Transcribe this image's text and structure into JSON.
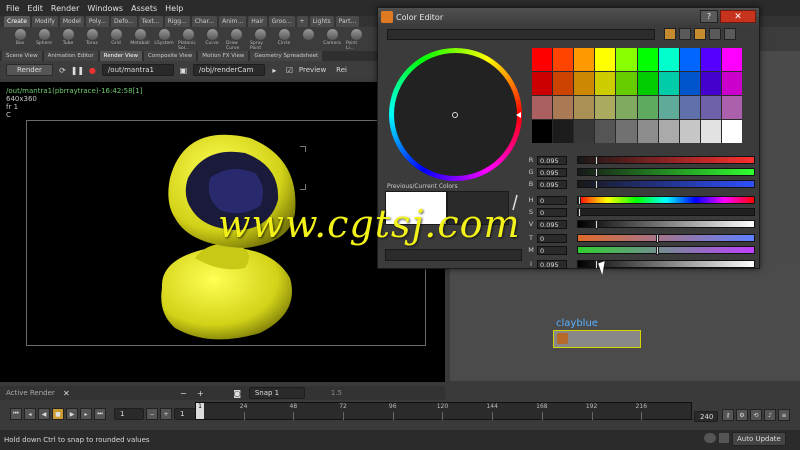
{
  "menu": [
    "File",
    "Edit",
    "Render",
    "Windows",
    "Assets",
    "Help"
  ],
  "shelf": {
    "tabs": [
      "Create",
      "Modify",
      "Model",
      "Poly...",
      "Defo...",
      "Text...",
      "Rigg...",
      "Char...",
      "Anim...",
      "Hair",
      "Groo...",
      "+",
      "Lights",
      "Part..."
    ],
    "tools": [
      "Box",
      "Sphere",
      "Tube",
      "Torus",
      "Grid",
      "Metaball",
      "LSystem",
      "Platonic Sol...",
      "Curve",
      "Draw Curve",
      "Spray Paint",
      "Circle",
      "",
      "Camera",
      "Point Li..."
    ]
  },
  "pane_tabs": [
    "Scene View",
    "Animation Editor",
    "Render View",
    "Composite View",
    "Motion FX View",
    "Geometry Spreadsheet"
  ],
  "render_toolbar": {
    "render_label": "Render",
    "output_path": "/out/mantra1",
    "camera_path": "/obj/renderCam",
    "preview_label": "Preview",
    "extra_label": "Rei"
  },
  "viewport": {
    "info_path": "/out/mantra1(pbrraytrace)-16:42:58[1]",
    "resolution": "640x360",
    "frame": "fr 1",
    "channel": "C"
  },
  "render_strip": {
    "active_render": "Active Render",
    "snap_label": "Snap 1",
    "zoom": "1.5"
  },
  "timeline": {
    "start_field": "1",
    "step_field": "1",
    "current_frame": "1",
    "end_field": "240",
    "ticks": [
      24,
      48,
      72,
      96,
      120,
      144,
      168,
      192,
      216
    ],
    "range": [
      1,
      240
    ]
  },
  "status": {
    "message": "Hold down Ctrl to snap to rounded values",
    "auto_update": "Auto Update"
  },
  "network": {
    "node_name": "clayblue"
  },
  "color_editor": {
    "title": "Color Editor",
    "help": "?",
    "close": "✕",
    "previous_current_label": "Previous/Current Colors",
    "previous_color": "#ffffff",
    "current_color": "#2a2a2a",
    "palette": [
      "#ff0000",
      "#ff4400",
      "#ff9900",
      "#ffff00",
      "#88ff00",
      "#00ff00",
      "#00ffcc",
      "#0066ff",
      "#5500ff",
      "#ff00ff",
      "#cc0000",
      "#cc4400",
      "#cc8800",
      "#cccc00",
      "#66cc00",
      "#00cc00",
      "#00ccaa",
      "#0055cc",
      "#4400cc",
      "#cc00cc",
      "#aa6060",
      "#aa7a55",
      "#aa9055",
      "#aaaa60",
      "#80aa60",
      "#60aa60",
      "#60aa99",
      "#6070aa",
      "#7060aa",
      "#aa60aa",
      "#000000",
      "#1c1c1c",
      "#383838",
      "#555555",
      "#717171",
      "#8d8d8d",
      "#aaaaaa",
      "#c6c6c6",
      "#e2e2e2",
      "#ffffff"
    ],
    "sliders": [
      {
        "label": "R",
        "value": "0.095",
        "fraction": 0.095,
        "gradient": "linear-gradient(90deg,#181818,#ff3030)"
      },
      {
        "label": "G",
        "value": "0.095",
        "fraction": 0.095,
        "gradient": "linear-gradient(90deg,#181818,#30ff30)"
      },
      {
        "label": "B",
        "value": "0.095",
        "fraction": 0.095,
        "gradient": "linear-gradient(90deg,#181818,#3050ff)"
      },
      {
        "label": "H",
        "value": "0",
        "fraction": 0.0,
        "gradient": "linear-gradient(90deg,#f00,#ff0,#0f0,#0ff,#00f,#f0f,#f00)"
      },
      {
        "label": "S",
        "value": "0",
        "fraction": 0.0,
        "gradient": "linear-gradient(90deg,#202020,#202020)"
      },
      {
        "label": "V",
        "value": "0.095",
        "fraction": 0.095,
        "gradient": "linear-gradient(90deg,#000,#fff)"
      },
      {
        "label": "T",
        "value": "0",
        "fraction": 0.45,
        "gradient": "linear-gradient(90deg,#e06a2a,#6080ff)"
      },
      {
        "label": "M",
        "value": "0",
        "fraction": 0.45,
        "gradient": "linear-gradient(90deg,#30d030,#c040ff)"
      },
      {
        "label": "I",
        "value": "0.095",
        "fraction": 0.095,
        "gradient": "linear-gradient(90deg,#000,#fff)"
      }
    ]
  },
  "watermark": "www.cgtsj.com",
  "colors": {
    "accent": "#c99a2e",
    "node_label": "#5ab1ff",
    "node_border": "#d4d400",
    "close_button": "#c8331e",
    "render_object": "#e3e31a"
  }
}
